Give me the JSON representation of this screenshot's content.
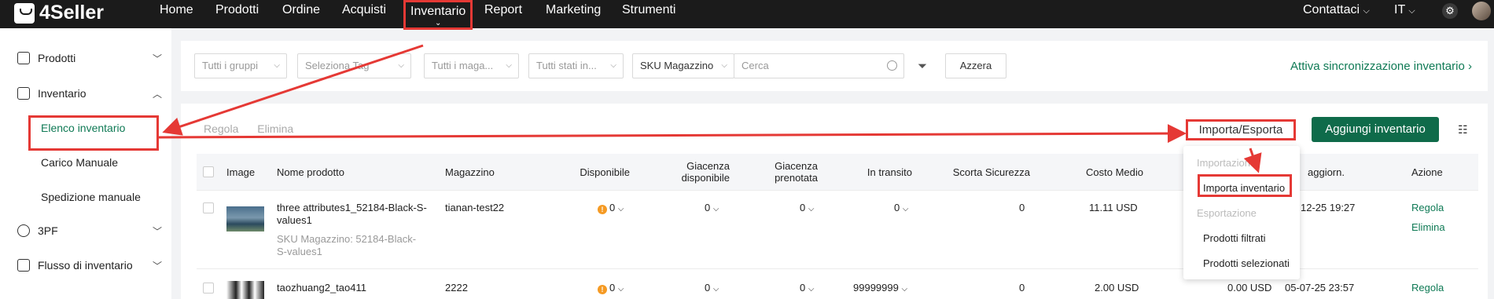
{
  "app": {
    "brand": "4Seller"
  },
  "topnav": {
    "items": [
      "Home",
      "Prodotti",
      "Ordine",
      "Acquisti",
      "Inventario",
      "Report",
      "Marketing",
      "Strumenti"
    ],
    "active": "Inventario",
    "contact": "Contattaci",
    "language": "IT"
  },
  "sidebar": {
    "groups": [
      {
        "label": "Prodotti",
        "icon": "product-icon",
        "expanded": false
      },
      {
        "label": "Inventario",
        "icon": "inventory-icon",
        "expanded": true
      },
      {
        "label": "3PF",
        "icon": "3pf-icon",
        "expanded": false
      },
      {
        "label": "Flusso di inventario",
        "icon": "flow-icon",
        "expanded": false
      }
    ],
    "inventory_children": [
      "Elenco inventario",
      "Carico Manuale",
      "Spedizione manuale"
    ],
    "active_child": "Elenco inventario"
  },
  "filters": {
    "group": "Tutti i gruppi",
    "tag": "Seleziona Tag",
    "warehouse": "Tutti i maga...",
    "status": "Tutti stati in...",
    "search_field": "SKU Magazzino",
    "search_placeholder": "Cerca",
    "reset": "Azzera",
    "sync_link": "Attiva sincronizzazione inventario"
  },
  "toolbar": {
    "tabs": [
      "Regola",
      "Elimina"
    ],
    "import_export": "Importa/Esporta",
    "add_inventory": "Aggiungi inventario"
  },
  "table": {
    "headers": {
      "image": "Image",
      "name": "Nome prodotto",
      "warehouse": "Magazzino",
      "available": "Disponibile",
      "stock_available_1": "Giacenza",
      "stock_available_2": "disponibile",
      "stock_reserved_1": "Giacenza",
      "stock_reserved_2": "prenotata",
      "in_transit": "In transito",
      "safety": "Scorta Sicurezza",
      "avg_cost": "Costo Medio",
      "updated": "aggiorn.",
      "action": "Azione"
    },
    "rows": [
      {
        "name_1": "three attributes1_52184-Black-S-",
        "name_2": "values1",
        "sku_1": "SKU Magazzino: 52184-Black-",
        "sku_2": "S-values1",
        "warehouse": "tianan-test22",
        "available": "0",
        "stock_available": "0",
        "stock_reserved": "0",
        "in_transit": "0",
        "safety": "0",
        "avg_cost": "11.11 USD",
        "updated": "12-25 19:27",
        "actions": [
          "Regola",
          "Elimina"
        ]
      },
      {
        "name_1": "taozhuang2_tao411",
        "warehouse": "2222",
        "available": "0",
        "stock_available": "0",
        "stock_reserved": "0",
        "in_transit": "99999999",
        "safety": "0",
        "avg_cost": "2.00 USD",
        "total_value": "0.00 USD",
        "updated": "05-07-25 23:57",
        "actions": [
          "Regola"
        ]
      }
    ]
  },
  "dropdown": {
    "import_header": "Importazione",
    "import_item": "Importa inventario",
    "export_header": "Esportazione",
    "export_items": [
      "Prodotti filtrati",
      "Prodotti selezionati"
    ]
  },
  "colors": {
    "accent": "#0f7a55",
    "primary_button": "#0f6b4a",
    "annotation": "#e53935",
    "warning": "#f59a23"
  }
}
